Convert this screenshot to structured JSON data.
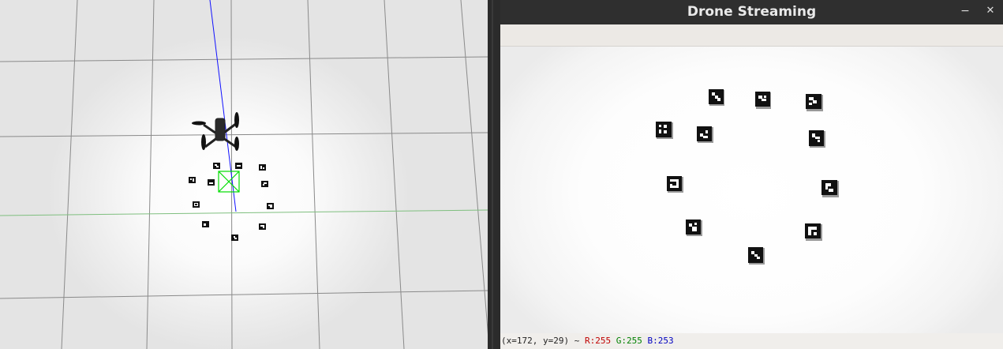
{
  "window": {
    "title": "Drone Streaming",
    "minimize_glyph": "−",
    "close_glyph": "✕"
  },
  "status": {
    "coords": "(x=172, y=29) ~",
    "r_label": "R:255",
    "g_label": "G:255",
    "b_label": "B:253"
  },
  "colors": {
    "status_r": "#c00000",
    "status_g": "#008000",
    "status_b": "#0000c0",
    "detection_box": "#00dd00",
    "trajectory": "#0000ff"
  },
  "icons": {
    "minimize": "minimize-icon",
    "close": "close-icon"
  }
}
